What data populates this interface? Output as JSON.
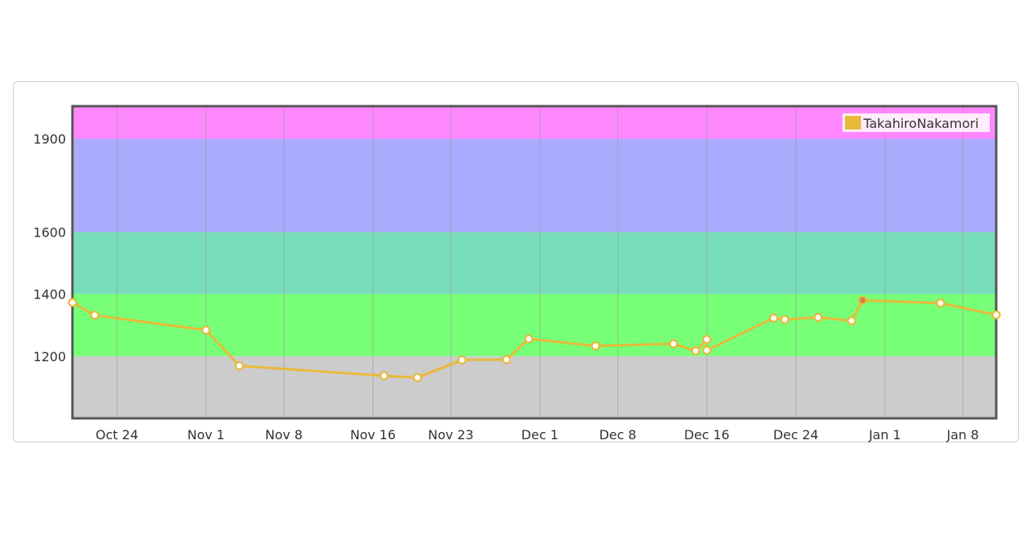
{
  "chart_data": {
    "type": "line",
    "legend": {
      "position": "top-right",
      "entries": [
        "TakahiroNakamori"
      ]
    },
    "colors": {
      "line": "#e9b93a",
      "marker_fill": "#ffffff",
      "last_marker_fill": "#c8824a",
      "band_gray": "#cccccc",
      "band_green": "#77ff77",
      "band_teal": "#77ddbb",
      "band_blue": "#aaaaff",
      "band_pink": "#ff88ff",
      "grid": "#999999",
      "border": "#555555"
    },
    "bands": [
      {
        "from": 1000,
        "to": 1200,
        "color": "#cccccc"
      },
      {
        "from": 1200,
        "to": 1400,
        "color": "#77ff77"
      },
      {
        "from": 1400,
        "to": 1600,
        "color": "#77ddbb"
      },
      {
        "from": 1600,
        "to": 1900,
        "color": "#aaaaff"
      },
      {
        "from": 1900,
        "to": 2005,
        "color": "#ff88ff"
      }
    ],
    "xlim": [
      "2014-10-20",
      "2015-01-11"
    ],
    "ylim": [
      1000,
      2005
    ],
    "x_ticks": [
      {
        "label": "Oct 24",
        "date": "2014-10-24"
      },
      {
        "label": "Nov 1",
        "date": "2014-11-01"
      },
      {
        "label": "Nov 8",
        "date": "2014-11-08"
      },
      {
        "label": "Nov 16",
        "date": "2014-11-16"
      },
      {
        "label": "Nov 23",
        "date": "2014-11-23"
      },
      {
        "label": "Dec 1",
        "date": "2014-12-01"
      },
      {
        "label": "Dec 8",
        "date": "2014-12-08"
      },
      {
        "label": "Dec 16",
        "date": "2014-12-16"
      },
      {
        "label": "Dec 24",
        "date": "2014-12-24"
      },
      {
        "label": "Jan 1",
        "date": "2015-01-01"
      },
      {
        "label": "Jan 8",
        "date": "2015-01-08"
      }
    ],
    "y_ticks": [
      1200,
      1400,
      1600,
      1900
    ],
    "series": [
      {
        "name": "TakahiroNakamori",
        "points": [
          {
            "x": "2014-10-20",
            "y": 1373
          },
          {
            "x": "2014-10-22",
            "y": 1332
          },
          {
            "x": "2014-11-01",
            "y": 1284
          },
          {
            "x": "2014-11-04",
            "y": 1169
          },
          {
            "x": "2014-11-17",
            "y": 1137
          },
          {
            "x": "2014-11-20",
            "y": 1131
          },
          {
            "x": "2014-11-24",
            "y": 1188
          },
          {
            "x": "2014-11-28",
            "y": 1189
          },
          {
            "x": "2014-11-30",
            "y": 1256
          },
          {
            "x": "2014-12-06",
            "y": 1233
          },
          {
            "x": "2014-12-13",
            "y": 1240
          },
          {
            "x": "2014-12-15",
            "y": 1217
          },
          {
            "x": "2014-12-16",
            "y": 1254
          },
          {
            "x": "2014-12-16",
            "y": 1219
          },
          {
            "x": "2014-12-22",
            "y": 1323
          },
          {
            "x": "2014-12-23",
            "y": 1318
          },
          {
            "x": "2014-12-26",
            "y": 1325
          },
          {
            "x": "2014-12-29",
            "y": 1314
          },
          {
            "x": "2014-12-30",
            "y": 1380
          },
          {
            "x": "2015-01-06",
            "y": 1371
          },
          {
            "x": "2015-01-11",
            "y": 1333
          }
        ]
      }
    ]
  }
}
